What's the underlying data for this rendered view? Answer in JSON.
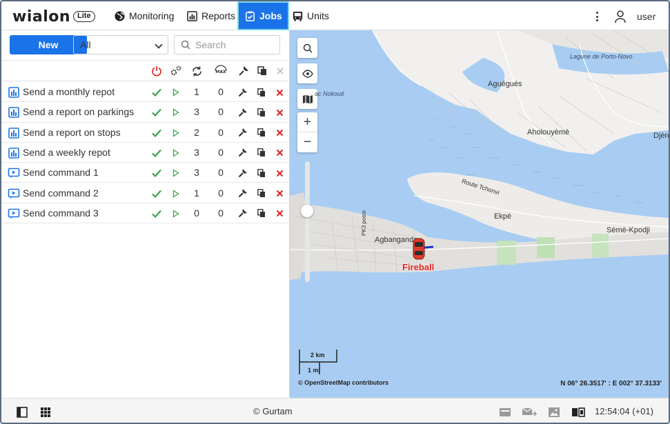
{
  "header": {
    "logo": {
      "word": "wialon",
      "badge": "Lite"
    },
    "nav": [
      {
        "label": "Monitoring",
        "icon": "globe-icon",
        "active": false
      },
      {
        "label": "Reports",
        "icon": "reports-icon",
        "active": true
      },
      {
        "label": "Jobs",
        "icon": "jobs-icon",
        "active": true
      },
      {
        "label": "Units",
        "icon": "bus-icon",
        "active": false
      }
    ],
    "user": "user",
    "accent": "#1a73e8"
  },
  "toolbar": {
    "new_label": "New",
    "filter_value": "All",
    "search_placeholder": "Search"
  },
  "jobs": [
    {
      "name": "Send a monthly repot",
      "type": "report",
      "runs": "1",
      "max": "0"
    },
    {
      "name": "Send a report on parkings",
      "type": "report",
      "runs": "3",
      "max": "0"
    },
    {
      "name": "Send a report on stops",
      "type": "report",
      "runs": "2",
      "max": "0"
    },
    {
      "name": "Send a weekly repot",
      "type": "report",
      "runs": "3",
      "max": "0"
    },
    {
      "name": "Send command 1",
      "type": "command",
      "runs": "3",
      "max": "0"
    },
    {
      "name": "Send command 2",
      "type": "command",
      "runs": "1",
      "max": "0"
    },
    {
      "name": "Send command 3",
      "type": "command",
      "runs": "0",
      "max": "0"
    }
  ],
  "map": {
    "labels": {
      "lagune": "Lagune de Porto-Novo",
      "lac": "ac Nokoué",
      "agueges": "Aguégués",
      "aholouyeme": "Aholouyèmè",
      "djeregbe": "Djère",
      "route": "Route Tchonvi",
      "ekpe": "Ekpè",
      "seme": "Sèmè-Kpodji",
      "agbanganda": "Agbangandа",
      "pk3": "PK3 poste"
    },
    "unit_name": "Fireball",
    "scale_km": "2 km",
    "scale_mi": "1 mi",
    "attribution": "© OpenStreetMap contributors",
    "coords": "N 06° 26.3517' : E 002° 37.3133'"
  },
  "footer": {
    "copyright": "© Gurtam",
    "clock": "12:54:04 (+01)"
  }
}
